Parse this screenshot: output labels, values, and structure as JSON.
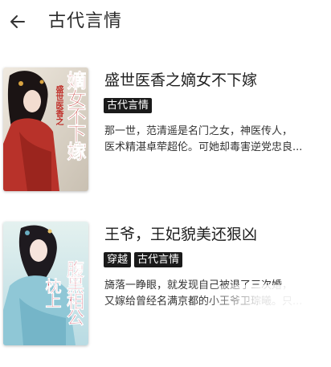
{
  "header": {
    "title": "古代言情",
    "back_icon": "arrow-left-icon"
  },
  "books": [
    {
      "title": "盛世医香之嫡女不下嫁",
      "tags": [
        "古代言情"
      ],
      "synopsis_lines": [
        "那一世，范清遥是名门之女，神医传人，",
        "医术精湛卓荦超伦。可她却毒害逆党忠良..."
      ],
      "cover_text": "嫡女不下嫁",
      "cover_sub": "盛世医香之",
      "cover_colors": {
        "bg": "#d9d3c8",
        "accent": "#c0312b",
        "robe": "#b8322a"
      }
    },
    {
      "title": "王爷，王妃貌美还狠凶",
      "tags": [
        "穿越",
        "古代言情"
      ],
      "synopsis_lines": [
        "旖落一睁眼，就发现自己被退了三次婚，",
        "又嫁给曾经名满京都的小王爷卫琮曦。只..."
      ],
      "cover_text_a": "腹黑相公",
      "cover_text_b": "枕上",
      "cover_colors": {
        "bg": "#cfe5ea",
        "accent": "#c13a52",
        "robe": "#8fc7d6"
      }
    }
  ]
}
